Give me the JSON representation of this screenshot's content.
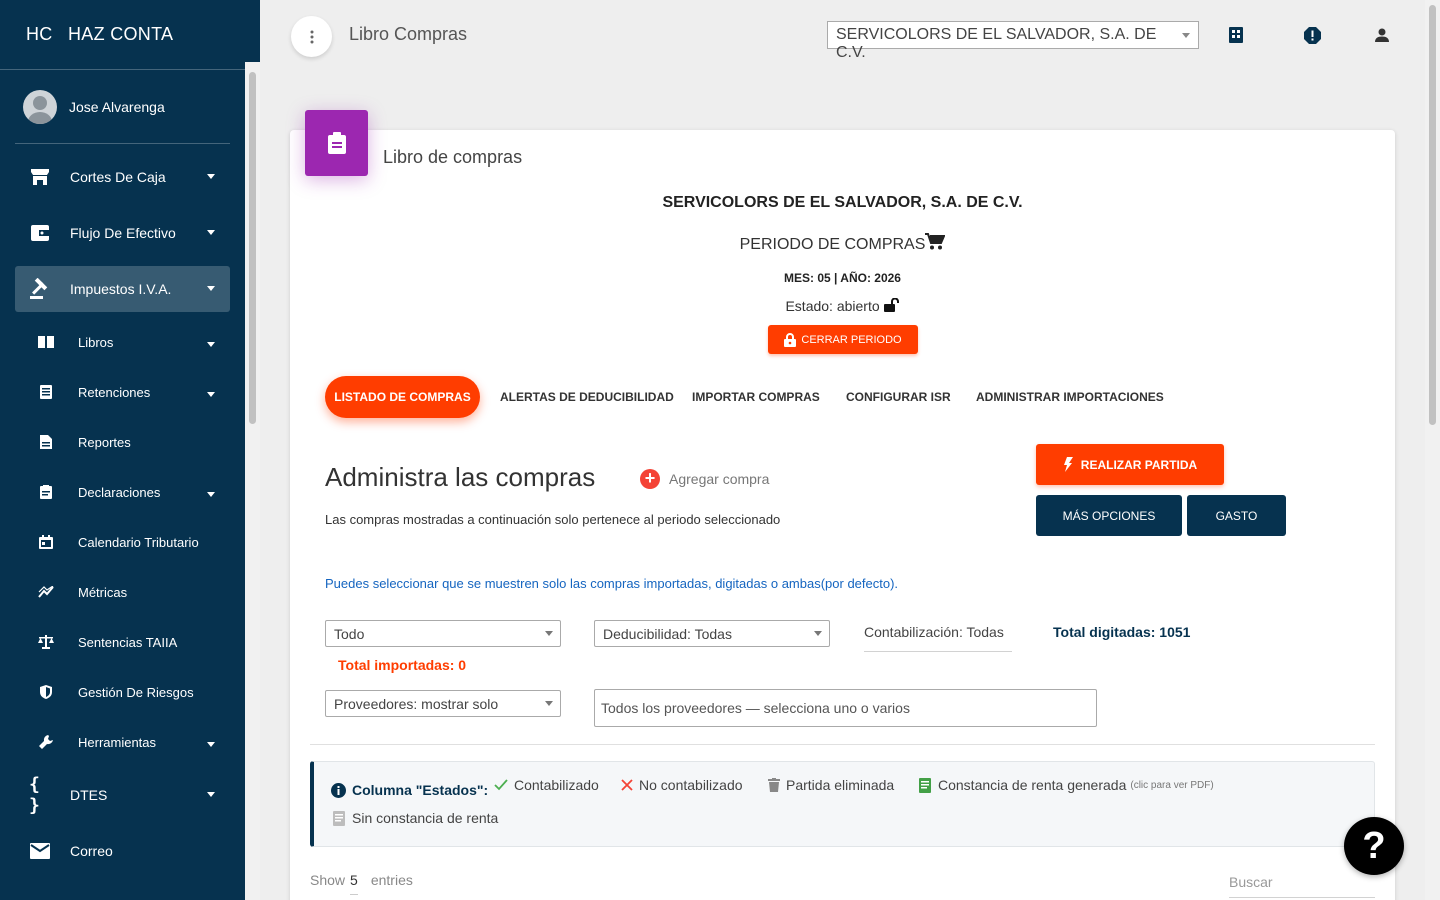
{
  "brand": {
    "mini": "HC",
    "name": "HAZ CONTA"
  },
  "user": {
    "name": "Jose Alvarenga"
  },
  "sidebar": {
    "items": [
      {
        "label": "Cortes De Caja",
        "icon": "store-icon"
      },
      {
        "label": "Flujo De Efectivo",
        "icon": "wallet-icon"
      },
      {
        "label": "Impuestos I.V.A.",
        "icon": "gavel-icon"
      }
    ],
    "sub_items": [
      {
        "label": "Libros",
        "icon": "book-icon"
      },
      {
        "label": "Retenciones",
        "icon": "receipt-icon"
      },
      {
        "label": "Reportes",
        "icon": "document-icon"
      },
      {
        "label": "Declaraciones",
        "icon": "clipboard-icon"
      },
      {
        "label": "Calendario Tributario",
        "icon": "calendar-icon"
      },
      {
        "label": "Métricas",
        "icon": "chart-icon"
      },
      {
        "label": "Sentencias TAIIA",
        "icon": "scale-icon"
      },
      {
        "label": "Gestión De Riesgos",
        "icon": "shield-icon"
      },
      {
        "label": "Herramientas",
        "icon": "wrench-icon"
      }
    ],
    "bottom_items": [
      {
        "label": "DTES",
        "icon": "braces-icon"
      },
      {
        "label": "Correo",
        "icon": "mail-icon"
      }
    ]
  },
  "header": {
    "title": "Libro Compras",
    "company_select": "SERVICOLORS DE EL SALVADOR, S.A. DE C.V."
  },
  "card": {
    "title": "Libro de compras",
    "company": "SERVICOLORS DE EL SALVADOR, S.A. DE C.V.",
    "period_label": "PERIODO DE COMPRAS",
    "mes": "MES: 05 | AÑO: 2026",
    "estado": "Estado: abierto",
    "cerrar_btn": "CERRAR PERIODO"
  },
  "tabs": [
    "LISTADO DE COMPRAS",
    "ALERTAS DE DEDUCIBILIDAD",
    "IMPORTAR COMPRAS",
    "CONFIGURAR ISR",
    "ADMINISTRAR IMPORTACIONES"
  ],
  "main": {
    "title": "Administra las compras",
    "add_label": "Agregar compra",
    "description": "Las compras mostradas a continuación solo pertenece al periodo seleccionado",
    "btn_partida": "REALIZAR PARTIDA",
    "btn_mas": "MÁS OPCIONES",
    "btn_gasto": "GASTO",
    "info": "Puedes seleccionar que se muestren solo las compras importadas, digitadas o ambas(por defecto)."
  },
  "filters": {
    "tipo": "Todo",
    "deducibilidad": "Deducibilidad: Todas",
    "contabilizacion": "Contabilización: Todas",
    "total_digitadas": "Total digitadas: 1051",
    "total_importadas": "Total importadas: 0",
    "proveedores": "Proveedores: mostrar solo",
    "proveedores_input": "Todos los proveedores — selecciona uno o varios"
  },
  "legend": {
    "title": "Columna \"Estados\":",
    "contabilizado": "Contabilizado",
    "no_contabilizado": "No contabilizado",
    "partida_eliminada": "Partida eliminada",
    "constancia": "Constancia de renta generada",
    "constancia_hint": "(clic para ver PDF)",
    "sin_constancia": "Sin constancia de renta"
  },
  "table_controls": {
    "show": "Show",
    "entries_value": "5",
    "entries": "entries",
    "search": "Buscar"
  },
  "help": "?",
  "colors": {
    "sidebar": "#06324f",
    "accent": "#ff3d00",
    "card_icon": "#9c27b0",
    "info": "#1565c0"
  }
}
